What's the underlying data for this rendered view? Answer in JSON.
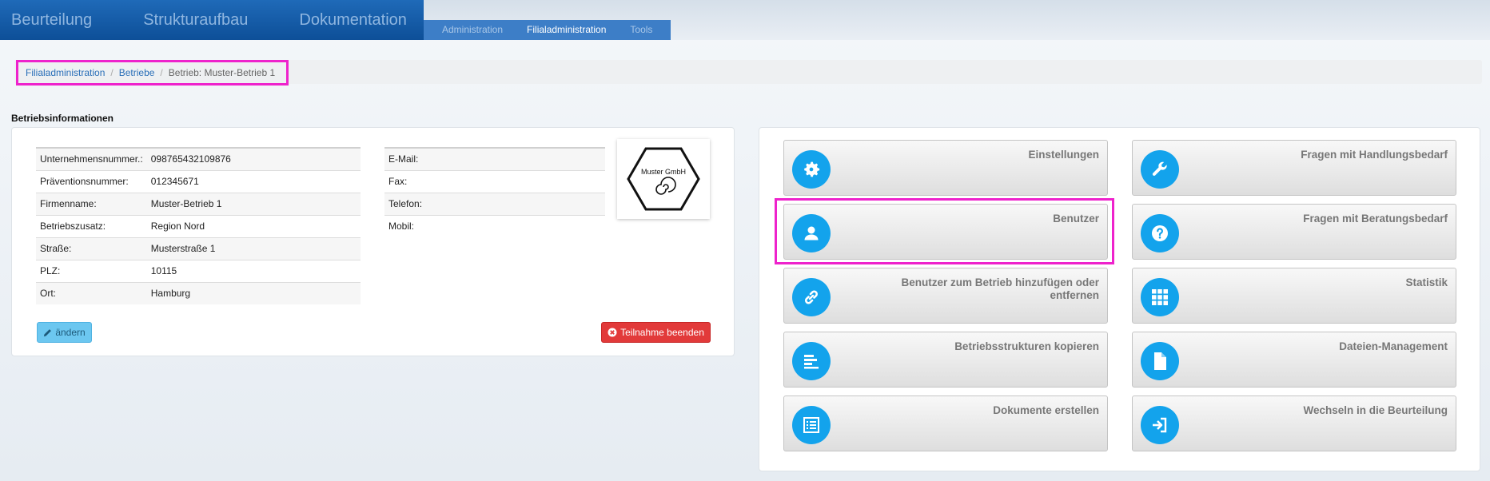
{
  "nav": {
    "main_tabs": [
      "Beurteilung",
      "Strukturaufbau",
      "Dokumentation"
    ],
    "sub_tabs": [
      "Administration",
      "Filialadministration",
      "Tools"
    ],
    "active_sub_tab": "Filialadministration"
  },
  "breadcrumb": {
    "items": [
      "Filialadministration",
      "Betriebe"
    ],
    "current": "Betrieb: Muster-Betrieb 1"
  },
  "section_title": "Betriebsinformationen",
  "company_info": [
    {
      "label": "Unternehmensnummer.:",
      "value": "098765432109876"
    },
    {
      "label": "Präventionsnummer:",
      "value": "012345671"
    },
    {
      "label": "Firmenname:",
      "value": "Muster-Betrieb 1"
    },
    {
      "label": "Betriebszusatz:",
      "value": "Region Nord"
    },
    {
      "label": "Straße:",
      "value": "Musterstraße 1"
    },
    {
      "label": "PLZ:",
      "value": "10115"
    },
    {
      "label": "Ort:",
      "value": "Hamburg"
    }
  ],
  "contact_info": [
    {
      "label": "E-Mail:",
      "value": ""
    },
    {
      "label": "Fax:",
      "value": ""
    },
    {
      "label": "Telefon:",
      "value": ""
    },
    {
      "label": "Mobil:",
      "value": ""
    }
  ],
  "logo": {
    "text": "Muster GmbH"
  },
  "buttons": {
    "edit": "ändern",
    "end": "Teilnahme beenden"
  },
  "tiles": [
    {
      "label": "Einstellungen",
      "icon": "gear-icon"
    },
    {
      "label": "Fragen mit Handlungsbedarf",
      "icon": "wrench-icon"
    },
    {
      "label": "Benutzer",
      "icon": "user-icon"
    },
    {
      "label": "Fragen mit Beratungsbedarf",
      "icon": "question-icon"
    },
    {
      "label": "Benutzer zum Betrieb hinzufügen oder entfernen",
      "icon": "link-icon"
    },
    {
      "label": "Statistik",
      "icon": "grid-icon"
    },
    {
      "label": "Betriebsstrukturen kopieren",
      "icon": "bars-icon"
    },
    {
      "label": "Dateien-Management",
      "icon": "file-icon"
    },
    {
      "label": "Dokumente erstellen",
      "icon": "list-icon"
    },
    {
      "label": "Wechseln in die Beurteilung",
      "icon": "sign-in-icon"
    }
  ],
  "colors": {
    "nav_blue": "#0d4f98",
    "tile_icon_blue": "#13a3ec",
    "highlight": "#ee22cc",
    "danger": "#e23a3a",
    "info": "#6cc7f0"
  }
}
